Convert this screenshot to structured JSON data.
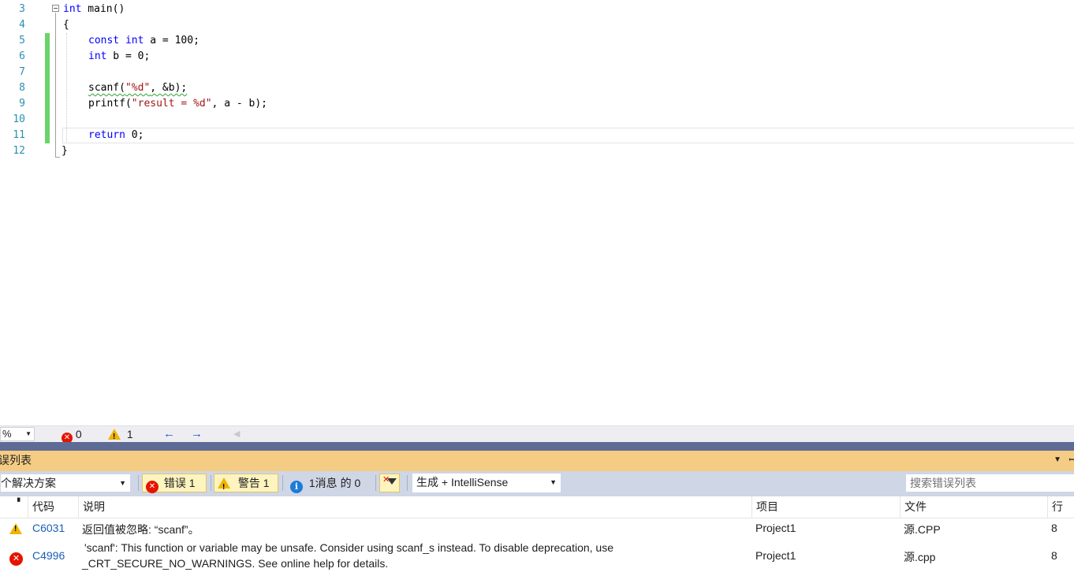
{
  "editor": {
    "lines": [
      {
        "num": "3"
      },
      {
        "num": "4"
      },
      {
        "num": "5"
      },
      {
        "num": "6"
      },
      {
        "num": "7"
      },
      {
        "num": "8"
      },
      {
        "num": "9"
      },
      {
        "num": "10"
      },
      {
        "num": "11"
      },
      {
        "num": "12"
      }
    ],
    "code": {
      "l3_kw": "int",
      "l3_rest": " main()",
      "l4": "{",
      "l5_kw1": "const",
      "l5_kw2": "int",
      "l5_rest": " a = 100;",
      "l6_kw": "int",
      "l6_rest": " b = 0;",
      "l8_fn": "scanf(",
      "l8_str": "\"%d\"",
      "l8_rest": ", &b);",
      "l9_fn": "printf(",
      "l9_str": "\"result = %d\"",
      "l9_rest": ", a - b);",
      "l11_kw": "return",
      "l11_rest": " 0;",
      "l12": "}"
    }
  },
  "status": {
    "zoom": "%",
    "errors": "0",
    "warnings": "1"
  },
  "error_list": {
    "title": "误列表",
    "scope": "个解决方案",
    "errors_btn": "错误 1",
    "warnings_btn": "警告 1",
    "messages_btn": "1消息 的 0",
    "build_source": "生成 + IntelliSense",
    "search_placeholder": "搜索错误列表",
    "columns": {
      "code": "代码",
      "desc": "说明",
      "project": "项目",
      "file": "文件",
      "line": "行"
    },
    "rows": [
      {
        "severity": "warning",
        "code": "C6031",
        "desc": "返回值被忽略: “scanf”。",
        "desc2": "",
        "project": "Project1",
        "file": "源.CPP",
        "line": "8"
      },
      {
        "severity": "error",
        "code": "C4996",
        "desc": "'scanf': This function or variable may be unsafe. Consider using scanf_s instead. To disable deprecation, use",
        "desc2": "_CRT_SECURE_NO_WARNINGS. See online help for details.",
        "project": "Project1",
        "file": "源.cpp",
        "line": "8"
      }
    ]
  },
  "colors": {
    "keyword": "#0000ff",
    "string": "#a31515",
    "line_number": "#2b91af",
    "panel_title_bg": "#f5cc84",
    "toolbar_bg": "#cfd6e5",
    "error_red": "#e51400",
    "warning_yellow": "#f0b400"
  }
}
